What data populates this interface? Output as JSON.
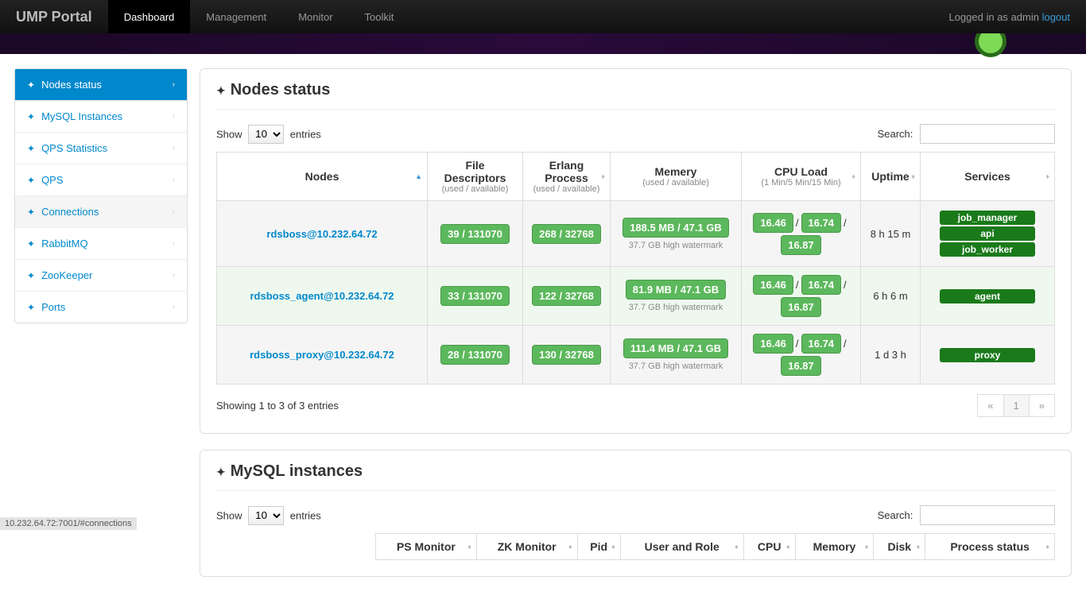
{
  "topnav": {
    "brand": "UMP Portal",
    "tabs": [
      "Dashboard",
      "Management",
      "Monitor",
      "Toolkit"
    ],
    "logged_text": "Logged in as admin",
    "logout": "logout"
  },
  "sidebar": {
    "items": [
      {
        "label": "Nodes status",
        "active": true
      },
      {
        "label": "MySQL Instances"
      },
      {
        "label": "QPS Statistics"
      },
      {
        "label": "QPS"
      },
      {
        "label": "Connections",
        "hover": true
      },
      {
        "label": "RabbitMQ"
      },
      {
        "label": "ZooKeeper"
      },
      {
        "label": "Ports"
      }
    ]
  },
  "nodes_panel": {
    "title": "Nodes status",
    "show_label": "Show",
    "entries_label": "entries",
    "page_size": "10",
    "search_label": "Search:",
    "columns": {
      "nodes": "Nodes",
      "fd": "File Descriptors",
      "fd_sub": "(used / available)",
      "erl": "Erlang Process",
      "erl_sub": "(used / available)",
      "mem": "Memery",
      "mem_sub": "(used / available)",
      "cpu": "CPU Load",
      "cpu_sub": "(1 Min/5 Min/15 Min)",
      "uptime": "Uptime",
      "services": "Services"
    },
    "rows": [
      {
        "node": "rdsboss@10.232.64.72",
        "fd": "39 / 131070",
        "erl": "268 / 32768",
        "mem": "188.5 MB / 47.1 GB",
        "watermark": "37.7 GB high watermark",
        "cpu1": "16.46",
        "cpu5": "16.74",
        "cpu15": "16.87",
        "uptime": "8 h 15 m",
        "services": [
          "job_manager",
          "api",
          "job_worker"
        ]
      },
      {
        "node": "rdsboss_agent@10.232.64.72",
        "fd": "33 / 131070",
        "erl": "122 / 32768",
        "mem": "81.9 MB / 47.1 GB",
        "watermark": "37.7 GB high watermark",
        "cpu1": "16.46",
        "cpu5": "16.74",
        "cpu15": "16.87",
        "uptime": "6 h 6 m",
        "services": [
          "agent"
        ]
      },
      {
        "node": "rdsboss_proxy@10.232.64.72",
        "fd": "28 / 131070",
        "erl": "130 / 32768",
        "mem": "111.4 MB / 47.1 GB",
        "watermark": "37.7 GB high watermark",
        "cpu1": "16.46",
        "cpu5": "16.74",
        "cpu15": "16.87",
        "uptime": "1 d 3 h",
        "services": [
          "proxy"
        ]
      }
    ],
    "info": "Showing 1 to 3 of 3 entries",
    "pager": {
      "prev": "«",
      "page": "1",
      "next": "»"
    }
  },
  "instances_panel": {
    "title": "MySQL instances",
    "show_label": "Show",
    "entries_label": "entries",
    "page_size": "10",
    "search_label": "Search:",
    "columns": [
      "PS Monitor",
      "ZK Monitor",
      "Pid",
      "User and Role",
      "CPU",
      "Memory",
      "Disk",
      "Process status"
    ]
  },
  "statusbar": "10.232.64.72:7001/#connections"
}
